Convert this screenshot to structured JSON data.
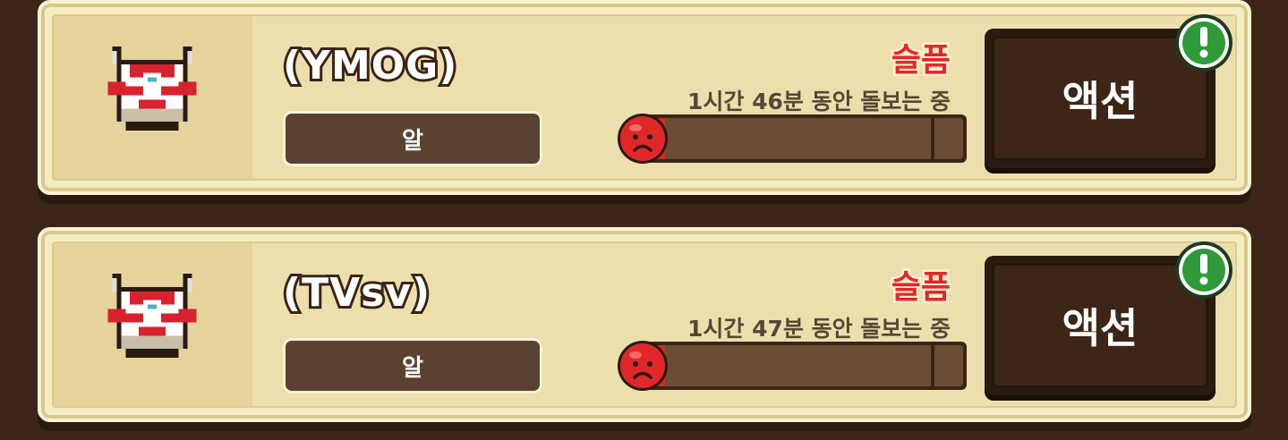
{
  "pets": [
    {
      "name": "(YMOG)",
      "stage": "알",
      "mood": "슬픔",
      "care_time": "1시간 46분 동안 돌보는 중",
      "mood_level": 0.08,
      "action_label": "액션",
      "alert_icon": "exclamation-badge-icon",
      "pet_icon": "red-white-armor-egg-icon",
      "mood_icon": "sad-face-icon"
    },
    {
      "name": "(TVsv)",
      "stage": "알",
      "mood": "슬픔",
      "care_time": "1시간 47분 동안 돌보는 중",
      "mood_level": 0.08,
      "action_label": "액션",
      "alert_icon": "exclamation-badge-icon",
      "pet_icon": "red-white-armor-egg-icon",
      "mood_icon": "sad-face-icon"
    }
  ],
  "colors": {
    "mood_text": "#e8242b",
    "card_bg": "#ecdfad",
    "button_bg": "#3d2618",
    "alert_green": "#2e9a3a"
  }
}
